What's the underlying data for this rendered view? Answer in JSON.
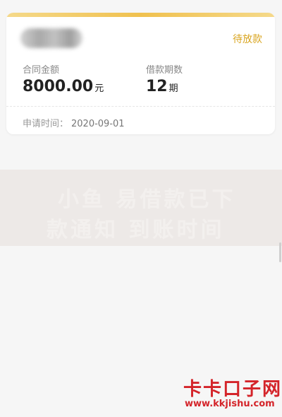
{
  "card": {
    "status": "待放款",
    "amount_label": "合同金额",
    "amount_value": "8000.00",
    "amount_unit": "元",
    "periods_label": "借款期数",
    "periods_value": "12",
    "periods_unit": "期",
    "apply_time_label": "申请时间：",
    "apply_time_value": "2020-09-01"
  },
  "overlay": {
    "line1": "小鱼 易借款已下",
    "line2": "款通知 到账时间"
  },
  "watermark": {
    "title": "卡卡口子网",
    "url": "www.kkjishu.com"
  },
  "colors": {
    "accent": "#f0c14f",
    "status": "#d9a520",
    "watermark": "#d4242a"
  }
}
